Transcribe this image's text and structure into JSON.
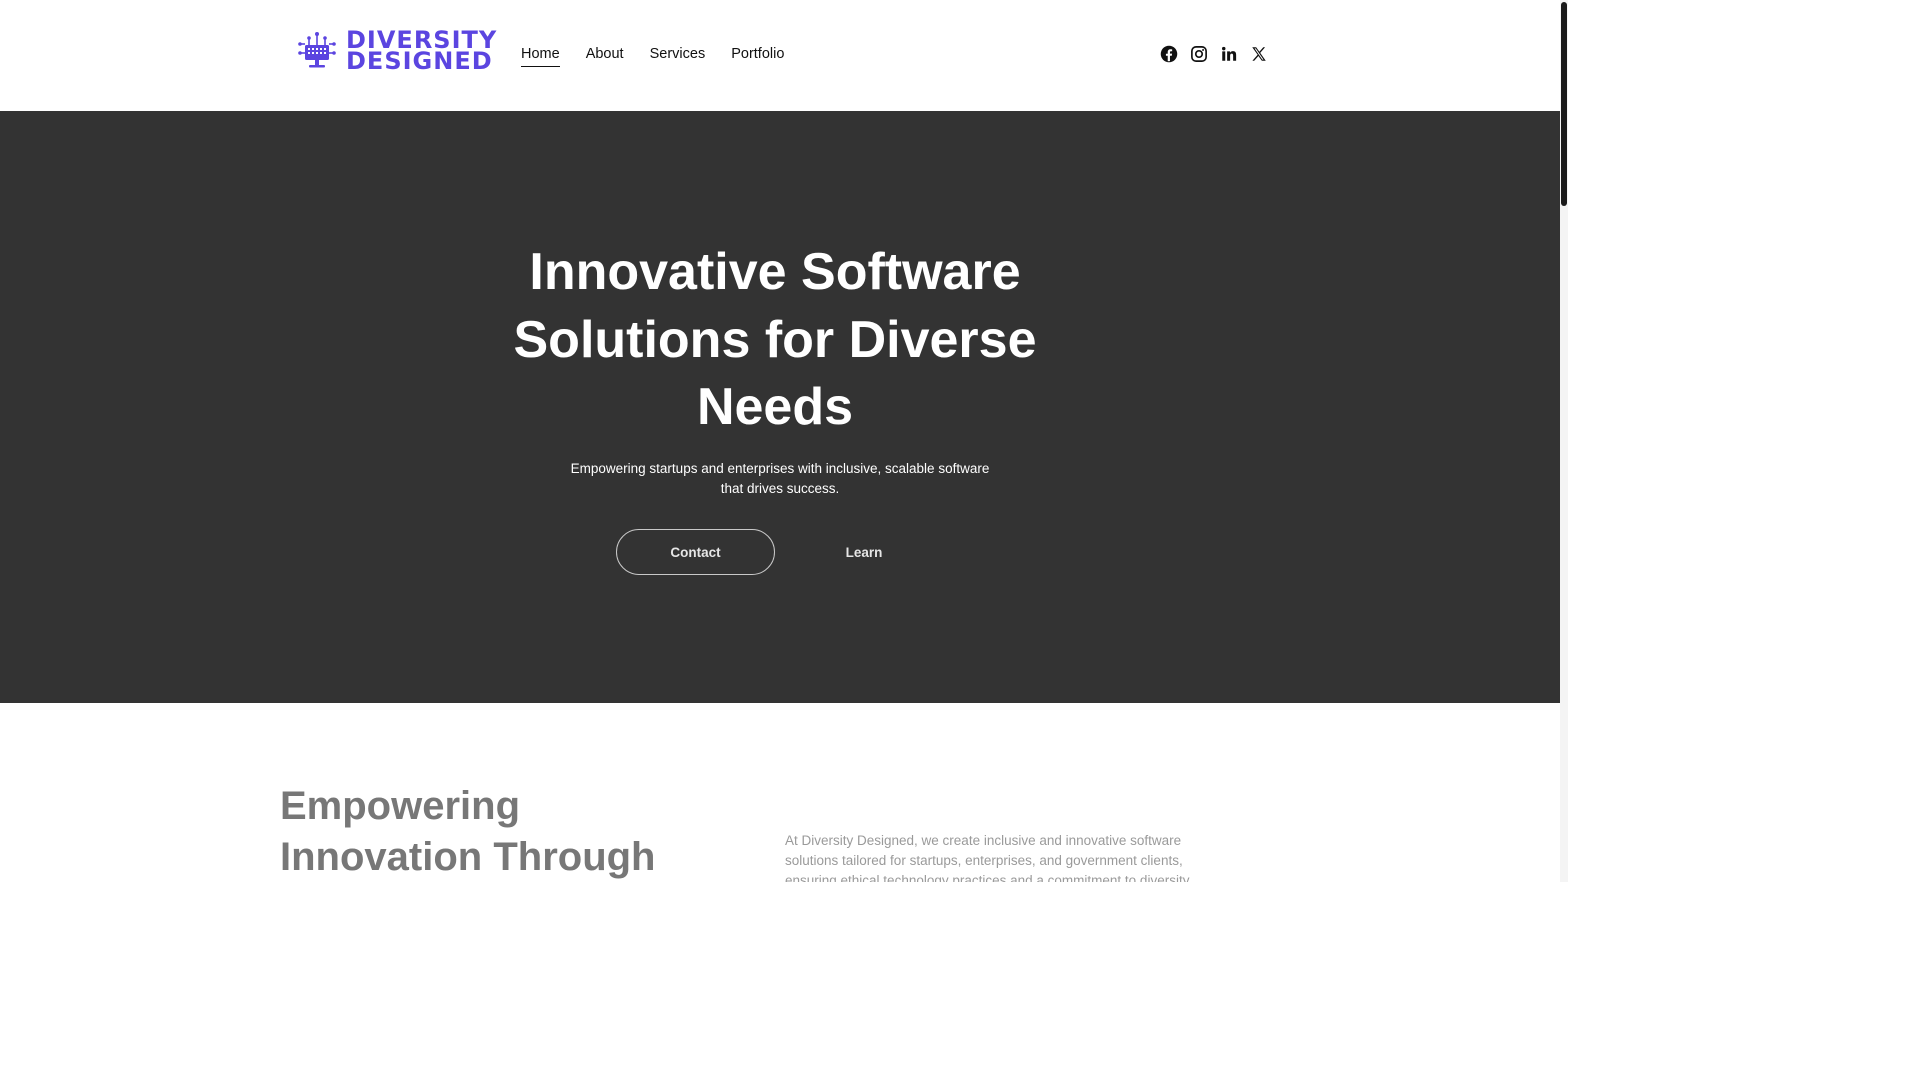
{
  "brand": {
    "line1": "DIVERSITY",
    "line2": "DESIGNED",
    "color": "#5b45e0"
  },
  "nav": {
    "items": [
      {
        "label": "Home",
        "active": true
      },
      {
        "label": "About",
        "active": false
      },
      {
        "label": "Services",
        "active": false
      },
      {
        "label": "Portfolio",
        "active": false
      }
    ]
  },
  "social": {
    "icons": [
      "facebook-icon",
      "instagram-icon",
      "linkedin-icon",
      "x-icon"
    ]
  },
  "hero": {
    "title": "Innovative Software Solutions for Diverse Needs",
    "subtitle": "Empowering startups and enterprises with inclusive, scalable software that drives success.",
    "contact_label": "Contact",
    "learn_label": "Learn",
    "background": "#333333"
  },
  "about": {
    "title": "Empowering Innovation Through",
    "text": "At Diversity Designed, we create inclusive and innovative software solutions tailored for startups, enterprises, and government clients, ensuring ethical technology practices and a commitment to diversity."
  }
}
